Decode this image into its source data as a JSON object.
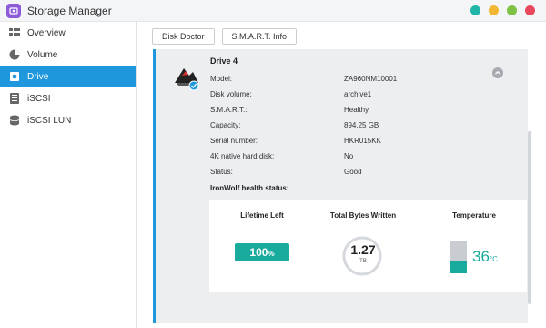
{
  "window": {
    "title": "Storage Manager",
    "controls": [
      {
        "name": "help",
        "color": "#1fb6a8"
      },
      {
        "name": "minimize",
        "color": "#f2b632"
      },
      {
        "name": "maximize",
        "color": "#7cc142"
      },
      {
        "name": "close",
        "color": "#e8475c"
      }
    ]
  },
  "sidebar": {
    "items": [
      {
        "label": "Overview",
        "icon": "overview-icon",
        "active": false
      },
      {
        "label": "Volume",
        "icon": "volume-icon",
        "active": false
      },
      {
        "label": "Drive",
        "icon": "drive-icon",
        "active": true
      },
      {
        "label": "iSCSI",
        "icon": "iscsi-icon",
        "active": false
      },
      {
        "label": "iSCSI LUN",
        "icon": "iscsi-lun-icon",
        "active": false
      }
    ]
  },
  "toolbar": {
    "disk_doctor": "Disk Doctor",
    "smart_info": "S.M.A.R.T. Info"
  },
  "drive": {
    "title": "Drive 4",
    "details": [
      {
        "label": "Model:",
        "value": "ZA960NM10001"
      },
      {
        "label": "Disk volume:",
        "value": "archive1"
      },
      {
        "label": "S.M.A.R.T.:",
        "value": "Healthy"
      },
      {
        "label": "Capacity:",
        "value": "894.25 GB"
      },
      {
        "label": "Serial number:",
        "value": "HKR015KK"
      },
      {
        "label": "4K native hard disk:",
        "value": "No"
      },
      {
        "label": "Status:",
        "value": "Good"
      }
    ],
    "health": {
      "title": "IronWolf health status:",
      "lifetime": {
        "label": "Lifetime Left",
        "value": "100",
        "unit": "%"
      },
      "tbw": {
        "label": "Total Bytes Written",
        "value": "1.27",
        "unit": "TB"
      },
      "temperature": {
        "label": "Temperature",
        "value": "36",
        "unit": "°C",
        "fill_fraction": 0.4
      }
    }
  },
  "colors": {
    "accent": "#1f97dd",
    "health": "#18aa9c"
  }
}
